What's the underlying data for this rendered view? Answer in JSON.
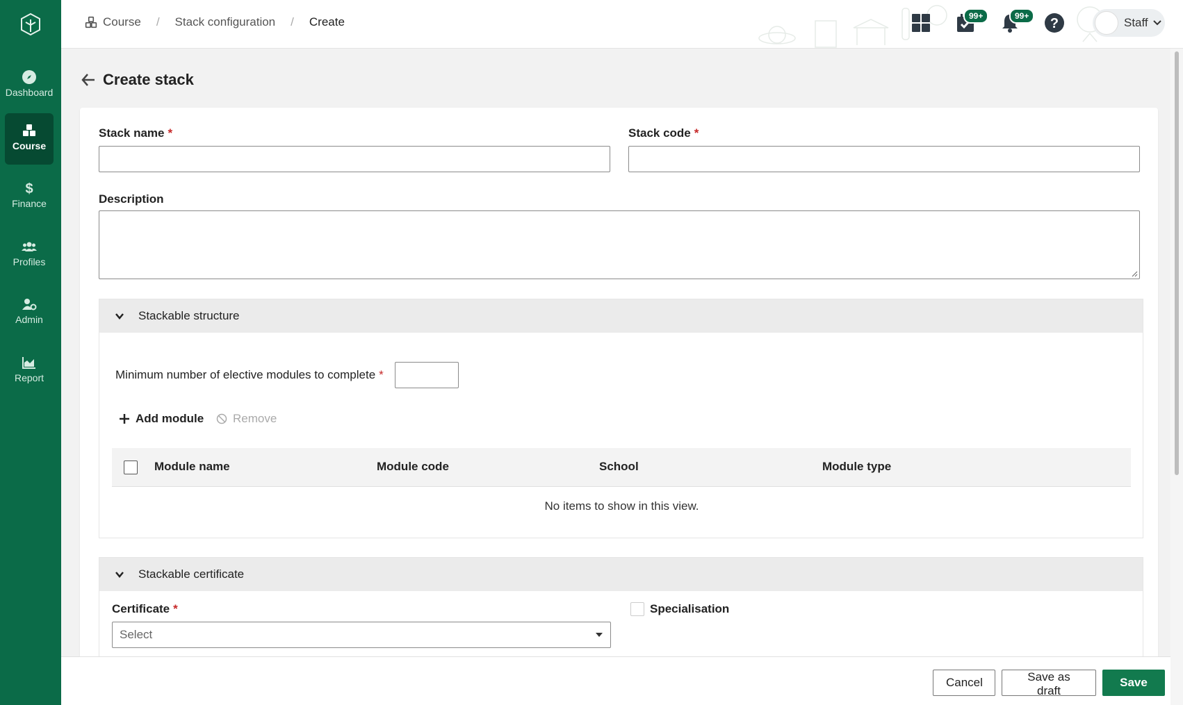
{
  "nav": {
    "items": [
      {
        "label": "Dashboard",
        "icon": "compass-icon"
      },
      {
        "label": "Course",
        "icon": "cubes-icon",
        "active": true
      },
      {
        "label": "Finance",
        "icon": "dollar-icon"
      },
      {
        "label": "Profiles",
        "icon": "users-icon"
      },
      {
        "label": "Admin",
        "icon": "user-gear-icon"
      },
      {
        "label": "Report",
        "icon": "area-chart-icon"
      }
    ]
  },
  "header": {
    "breadcrumb": [
      "Course",
      "Stack configuration",
      "Create"
    ],
    "tasks_badge": "99+",
    "notifications_badge": "99+",
    "user_label": "Staff"
  },
  "page": {
    "title": "Create stack"
  },
  "form": {
    "stack_name_label": "Stack name",
    "stack_code_label": "Stack code",
    "description_label": "Description",
    "required_mark": "*",
    "structure": {
      "title": "Stackable structure",
      "min_elective_label": "Minimum number of elective modules to complete",
      "add_module": "Add module",
      "remove": "Remove",
      "columns": [
        "Module name",
        "Module code",
        "School",
        "Module type"
      ],
      "empty_text": "No items to show in this view."
    },
    "certificate": {
      "title": "Stackable certificate",
      "certificate_label": "Certificate",
      "select_placeholder": "Select",
      "specialisation_label": "Specialisation"
    }
  },
  "footer": {
    "cancel": "Cancel",
    "save_draft": "Save as draft",
    "save": "Save"
  },
  "colors": {
    "brand": "#0b6b48",
    "primary_button": "#127a4e",
    "required": "#c62828"
  }
}
